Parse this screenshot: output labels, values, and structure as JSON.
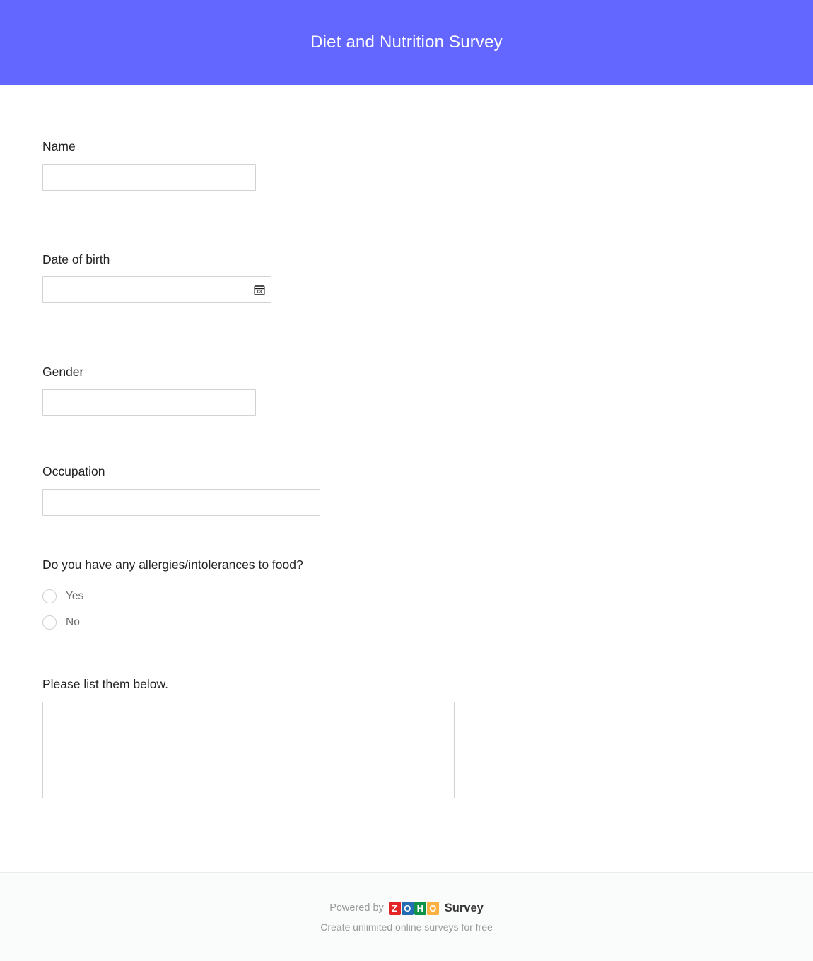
{
  "header": {
    "title": "Diet and Nutrition Survey",
    "background_color": "#6366ff",
    "title_color": "#ffffff"
  },
  "form": {
    "questions": [
      {
        "id": "name",
        "label": "Name",
        "type": "text",
        "value": "",
        "placeholder": ""
      },
      {
        "id": "date_of_birth",
        "label": "Date of birth",
        "type": "date",
        "value": "",
        "placeholder": "",
        "icon": "calendar-icon",
        "icon_day_text": "03"
      },
      {
        "id": "gender",
        "label": "Gender",
        "type": "text",
        "value": "",
        "placeholder": ""
      },
      {
        "id": "occupation",
        "label": "Occupation",
        "type": "text",
        "value": "",
        "placeholder": ""
      },
      {
        "id": "allergies",
        "label": "Do you have any allergies/intolerances to food?",
        "type": "radio",
        "selected": "",
        "options": [
          {
            "value": "yes",
            "label": "Yes"
          },
          {
            "value": "no",
            "label": "No"
          }
        ]
      },
      {
        "id": "allergy_list",
        "label": "Please list them below.",
        "type": "textarea",
        "value": "",
        "placeholder": ""
      }
    ]
  },
  "footer": {
    "powered_by": "Powered by",
    "brand_tiles": [
      {
        "letter": "Z",
        "color": "#e42527"
      },
      {
        "letter": "O",
        "color": "#226db4"
      },
      {
        "letter": "H",
        "color": "#0f9347"
      },
      {
        "letter": "O",
        "color": "#fbb03f"
      }
    ],
    "brand_word": "Survey",
    "tagline": "Create unlimited online surveys for free",
    "background_color": "#fafbfb"
  }
}
